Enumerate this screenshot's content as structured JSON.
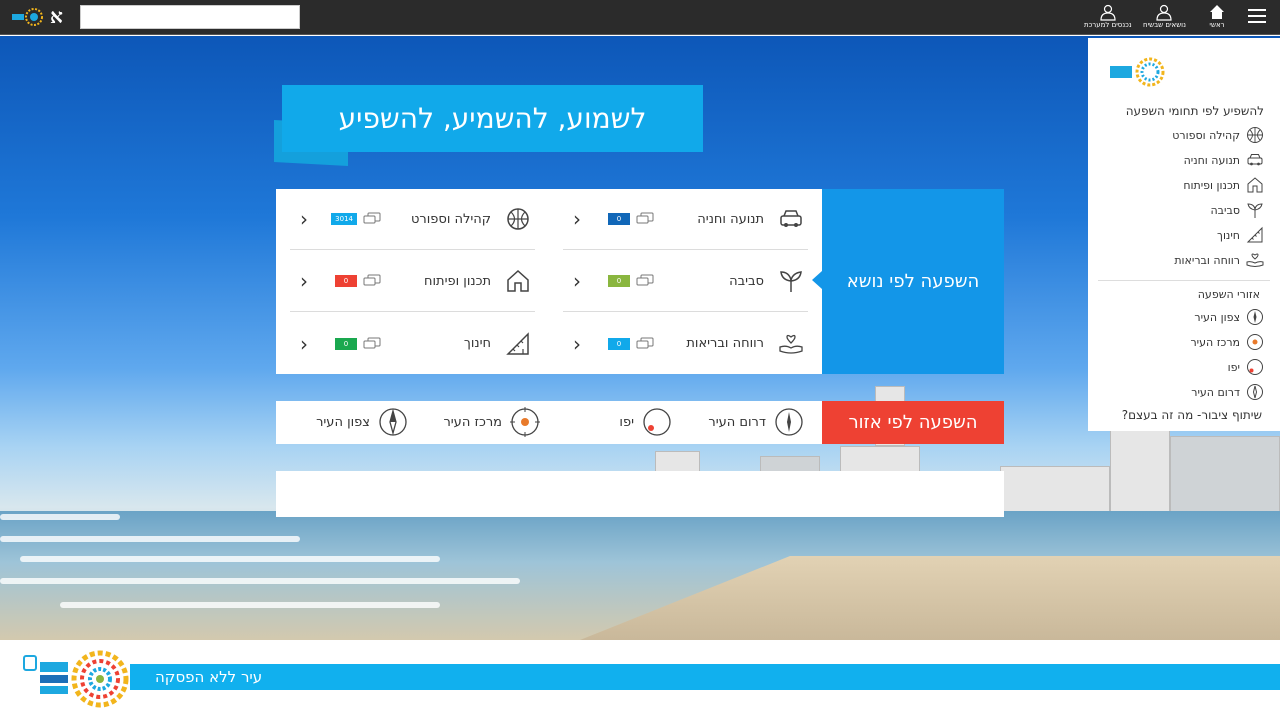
{
  "topbar": {
    "font_toggle": "א",
    "search_placeholder": "",
    "nav": [
      {
        "label": "ראשי",
        "icon": "home-icon"
      },
      {
        "label": "נושאים שבשיח",
        "icon": "person-icon"
      },
      {
        "label": "נכנסים למערכת",
        "icon": "person-icon"
      }
    ]
  },
  "headline": "לשמוע, להשמיע, להשפיע",
  "topics": {
    "label": "השפעה לפי נושא",
    "items": [
      {
        "name": "תנועה וחניה",
        "count": "0",
        "color": "#1167b8",
        "icon": "car-icon"
      },
      {
        "name": "קהילה וספורט",
        "count": "3014",
        "color": "#11a9ea",
        "icon": "ball-icon"
      },
      {
        "name": "סביבה",
        "count": "0",
        "color": "#8ab63f",
        "icon": "sprout-icon"
      },
      {
        "name": "תכנון ופיתוח",
        "count": "0",
        "color": "#ee4133",
        "icon": "house-icon"
      },
      {
        "name": "רווחה ובריאות",
        "count": "0",
        "color": "#11a9ea",
        "icon": "hand-heart-icon"
      },
      {
        "name": "חינוך",
        "count": "0",
        "color": "#1aa84f",
        "icon": "ruler-icon"
      }
    ]
  },
  "regions": {
    "label": "השפעה לפי אזור",
    "items": [
      {
        "name": "דרום העיר",
        "icon": "compass-south-icon"
      },
      {
        "name": "יפו",
        "icon": "compass-jaffa-icon"
      },
      {
        "name": "מרכז העיר",
        "icon": "compass-center-icon"
      },
      {
        "name": "צפון העיר",
        "icon": "compass-north-icon"
      }
    ]
  },
  "side_menu": {
    "title": "להשפיע לפי תחומי השפעה",
    "topics": [
      {
        "label": "קהילה וספורט",
        "icon": "ball-icon"
      },
      {
        "label": "תנועה וחניה",
        "icon": "car-icon"
      },
      {
        "label": "תכנון ופיתוח",
        "icon": "house-icon"
      },
      {
        "label": "סביבה",
        "icon": "sprout-icon"
      },
      {
        "label": "חינוך",
        "icon": "ruler-icon"
      },
      {
        "label": "רווחה ובריאות",
        "icon": "hand-heart-icon"
      }
    ],
    "section_title": "אזורי השפעה",
    "regions": [
      {
        "label": "צפון העיר",
        "icon": "compass-north-icon"
      },
      {
        "label": "מרכז העיר",
        "icon": "compass-center-icon"
      },
      {
        "label": "יפו",
        "icon": "compass-jaffa-icon"
      },
      {
        "label": "דרום העיר",
        "icon": "compass-south-icon"
      }
    ],
    "footer_link": "שיתוף ציבור- מה זה בעצם?"
  },
  "footer": {
    "slogan": "עיר ללא הפסקה"
  }
}
